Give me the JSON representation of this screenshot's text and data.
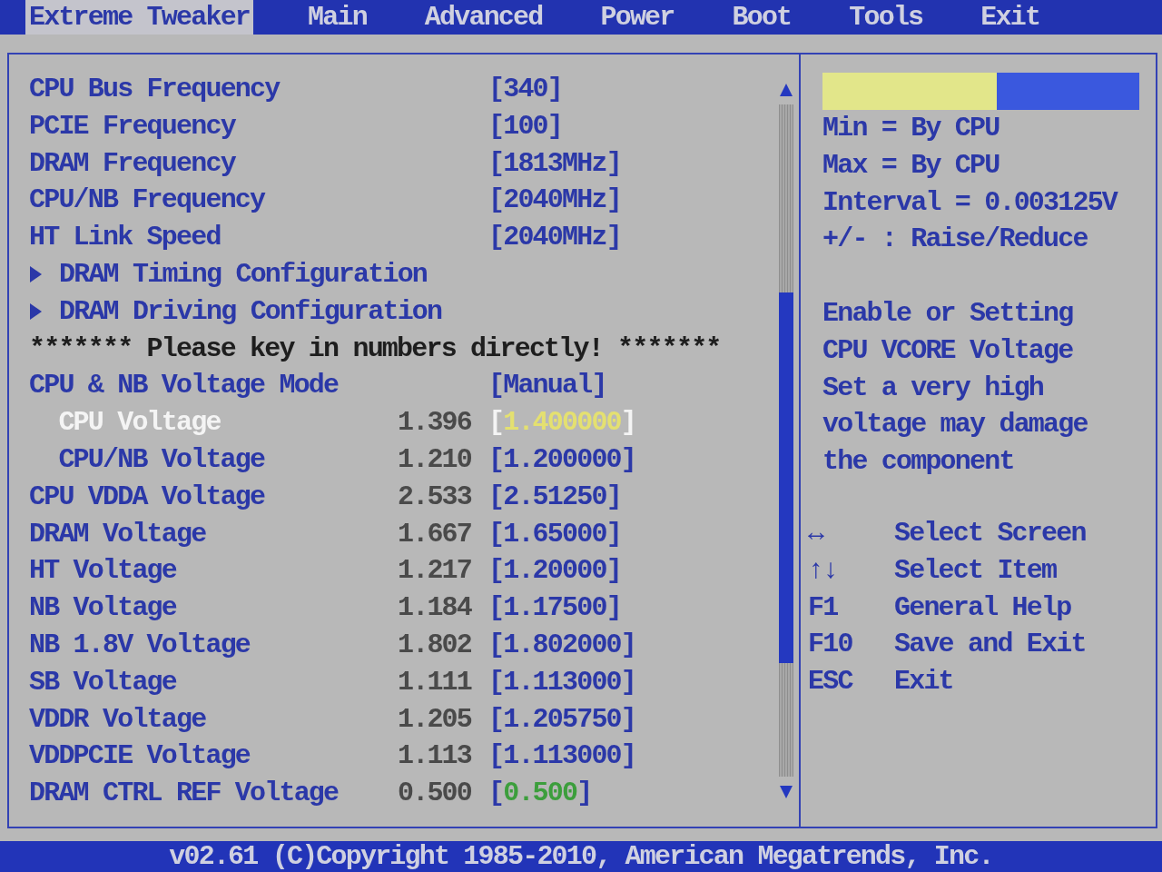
{
  "menu_bar": {
    "tabs": [
      {
        "label": "Extreme Tweaker",
        "selected": true
      },
      {
        "label": "Main",
        "selected": false
      },
      {
        "label": "Advanced",
        "selected": false
      },
      {
        "label": "Power",
        "selected": false
      },
      {
        "label": "Boot",
        "selected": false
      },
      {
        "label": "Tools",
        "selected": false
      },
      {
        "label": "Exit",
        "selected": false
      }
    ]
  },
  "settings": {
    "items": [
      {
        "kind": "setting",
        "label": "CPU Bus Frequency",
        "value": "[340]",
        "selected": false
      },
      {
        "kind": "setting",
        "label": "PCIE Frequency",
        "value": "[100]",
        "selected": false
      },
      {
        "kind": "setting",
        "label": "DRAM Frequency",
        "value": "[1813MHz]",
        "selected": false
      },
      {
        "kind": "setting",
        "label": "CPU/NB Frequency",
        "value": "[2040MHz]",
        "selected": false
      },
      {
        "kind": "setting",
        "label": "HT Link Speed",
        "value": "[2040MHz]",
        "selected": false
      },
      {
        "kind": "submenu",
        "label": "DRAM Timing Configuration",
        "selected": false
      },
      {
        "kind": "submenu",
        "label": "DRAM Driving Configuration",
        "selected": false
      },
      {
        "kind": "notice",
        "text": "******* Please key in numbers directly! *******"
      },
      {
        "kind": "setting",
        "label": "CPU & NB Voltage Mode",
        "value": "[Manual]",
        "selected": false,
        "children": [
          {
            "kind": "voltage",
            "label": "CPU Voltage",
            "reading": "1.396",
            "value": "[1.400000]",
            "selected": true
          },
          {
            "kind": "voltage",
            "label": "CPU/NB Voltage",
            "reading": "1.210",
            "value": "[1.200000]",
            "selected": false
          }
        ]
      },
      {
        "kind": "voltage",
        "label": "CPU VDDA Voltage",
        "reading": "2.533",
        "value": "[2.51250]",
        "selected": false
      },
      {
        "kind": "voltage",
        "label": "DRAM Voltage",
        "reading": "1.667",
        "value": "[1.65000]",
        "selected": false
      },
      {
        "kind": "voltage",
        "label": "HT Voltage",
        "reading": "1.217",
        "value": "[1.20000]",
        "selected": false
      },
      {
        "kind": "voltage",
        "label": "NB Voltage",
        "reading": "1.184",
        "value": "[1.17500]",
        "selected": false
      },
      {
        "kind": "voltage",
        "label": "NB 1.8V Voltage",
        "reading": "1.802",
        "value": "[1.802000]",
        "selected": false
      },
      {
        "kind": "voltage",
        "label": "SB Voltage",
        "reading": "1.111",
        "value": "[1.113000]",
        "selected": false
      },
      {
        "kind": "voltage",
        "label": "VDDR Voltage",
        "reading": "1.205",
        "value": "[1.205750]",
        "selected": false
      },
      {
        "kind": "voltage",
        "label": "VDDPCIE Voltage",
        "reading": "1.113",
        "value": "[1.113000]",
        "selected": false
      },
      {
        "kind": "voltage",
        "label": "DRAM CTRL REF Voltage",
        "reading": "0.500",
        "value": "[0.500]",
        "selected": false,
        "color": "#3c9e3c"
      }
    ]
  },
  "help_panel": {
    "meter": {
      "level": 0.55
    },
    "range_lines": [
      "Min = By CPU",
      "Max = By CPU",
      "Interval = 0.003125V",
      "+/- : Raise/Reduce"
    ],
    "description": "Enable or Setting CPU VCORE Voltage Set a very high voltage may damage the component"
  },
  "key_legend": [
    {
      "key": "↔",
      "action": "Select Screen"
    },
    {
      "key": "↑↓",
      "action": "Select Item"
    },
    {
      "key": "F1",
      "action": "General Help"
    },
    {
      "key": "F10",
      "action": "Save and Exit"
    },
    {
      "key": "ESC",
      "action": "Exit"
    }
  ],
  "status_bar": {
    "text": "v02.61 (C)Copyright 1985-2010, American Megatrends, Inc."
  }
}
